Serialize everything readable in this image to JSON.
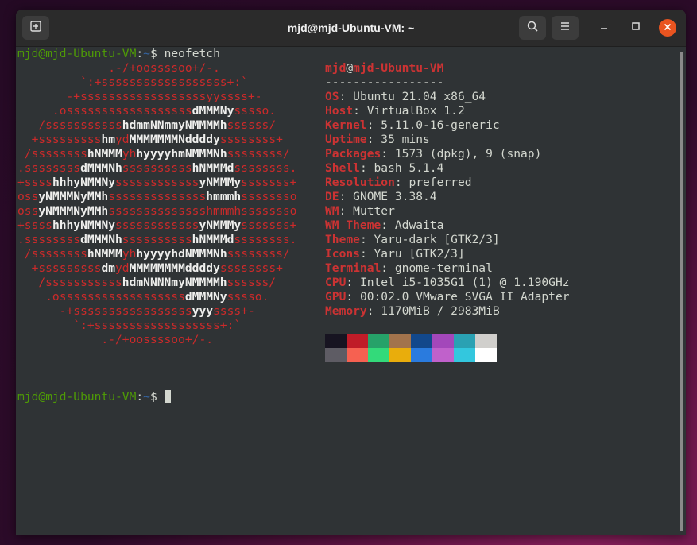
{
  "window": {
    "title": "mjd@mjd-Ubuntu-VM: ~",
    "icons": [
      "new-tab-icon",
      "search-icon",
      "hamburger-menu-icon",
      "minimize-icon",
      "maximize-icon",
      "close-icon"
    ]
  },
  "prompt": {
    "user_host": "mjd@mjd-Ubuntu-VM",
    "sep": ":",
    "dir": "~",
    "symbol": "$",
    "command": "neofetch"
  },
  "logo_lines": [
    [
      [
        "r",
        "             .-/+oossssoo+/-."
      ]
    ],
    [
      [
        "r",
        "         `:+ssssssssssssssssss+:`"
      ]
    ],
    [
      [
        "r",
        "       -+ssssssssssssssssssyyssss+-"
      ]
    ],
    [
      [
        "r",
        "     .ossssssssssssssssss"
      ],
      [
        "w",
        "dMMMNy"
      ],
      [
        "r",
        "sssso."
      ]
    ],
    [
      [
        "r",
        "   /sssssssssss"
      ],
      [
        "w",
        "hdmmNNmmyNMMMMh"
      ],
      [
        "r",
        "ssssss/"
      ]
    ],
    [
      [
        "r",
        "  +sssssssss"
      ],
      [
        "w",
        "hm"
      ],
      [
        "r",
        "yd"
      ],
      [
        "w",
        "MMMMMMMNddddy"
      ],
      [
        "r",
        "ssssssss+"
      ]
    ],
    [
      [
        "r",
        " /ssssssss"
      ],
      [
        "w",
        "hNMMM"
      ],
      [
        "r",
        "yh"
      ],
      [
        "w",
        "hyyyyhmNMMMNh"
      ],
      [
        "r",
        "ssssssss/"
      ]
    ],
    [
      [
        "r",
        ".ssssssss"
      ],
      [
        "w",
        "dMMMNh"
      ],
      [
        "r",
        "ssssssssss"
      ],
      [
        "w",
        "hNMMMd"
      ],
      [
        "r",
        "ssssssss."
      ]
    ],
    [
      [
        "r",
        "+ssss"
      ],
      [
        "w",
        "hhhyNMMNy"
      ],
      [
        "r",
        "ssssssssssss"
      ],
      [
        "w",
        "yNMMMy"
      ],
      [
        "r",
        "sssssss+"
      ]
    ],
    [
      [
        "r",
        "oss"
      ],
      [
        "w",
        "yNMMMNyMMh"
      ],
      [
        "r",
        "ssssssssssssss"
      ],
      [
        "w",
        "hmmmh"
      ],
      [
        "r",
        "ssssssso"
      ]
    ],
    [
      [
        "r",
        "oss"
      ],
      [
        "w",
        "yNMMMNyMMh"
      ],
      [
        "r",
        "sssssssssssssshmmmhssssssso"
      ]
    ],
    [
      [
        "r",
        "+ssss"
      ],
      [
        "w",
        "hhhyNMMNy"
      ],
      [
        "r",
        "ssssssssssss"
      ],
      [
        "w",
        "yNMMMy"
      ],
      [
        "r",
        "sssssss+"
      ]
    ],
    [
      [
        "r",
        ".ssssssss"
      ],
      [
        "w",
        "dMMMNh"
      ],
      [
        "r",
        "ssssssssss"
      ],
      [
        "w",
        "hNMMMd"
      ],
      [
        "r",
        "ssssssss."
      ]
    ],
    [
      [
        "r",
        " /ssssssss"
      ],
      [
        "w",
        "hNMMM"
      ],
      [
        "r",
        "yh"
      ],
      [
        "w",
        "hyyyyhdNMMMNh"
      ],
      [
        "r",
        "ssssssss/"
      ]
    ],
    [
      [
        "r",
        "  +sssssssss"
      ],
      [
        "w",
        "dm"
      ],
      [
        "r",
        "yd"
      ],
      [
        "w",
        "MMMMMMMMddddy"
      ],
      [
        "r",
        "ssssssss+"
      ]
    ],
    [
      [
        "r",
        "   /sssssssssss"
      ],
      [
        "w",
        "hdmNNNNmyNMMMMh"
      ],
      [
        "r",
        "ssssss/"
      ]
    ],
    [
      [
        "r",
        "    .ossssssssssssssssss"
      ],
      [
        "w",
        "dMMMNy"
      ],
      [
        "r",
        "sssso."
      ]
    ],
    [
      [
        "r",
        "      -+sssssssssssssssss"
      ],
      [
        "w",
        "yyy"
      ],
      [
        "r",
        "ssss+-"
      ]
    ],
    [
      [
        "r",
        "        `:+ssssssssssssssssss+:`"
      ]
    ],
    [
      [
        "r",
        "            .-/+oossssoo+/-."
      ]
    ]
  ],
  "info": {
    "user": "mjd",
    "at": "@",
    "host": "mjd-Ubuntu-VM",
    "divider": "-----------------",
    "rows": [
      {
        "key": "OS",
        "value": "Ubuntu 21.04 x86_64"
      },
      {
        "key": "Host",
        "value": "VirtualBox 1.2"
      },
      {
        "key": "Kernel",
        "value": "5.11.0-16-generic"
      },
      {
        "key": "Uptime",
        "value": "35 mins"
      },
      {
        "key": "Packages",
        "value": "1573 (dpkg), 9 (snap)"
      },
      {
        "key": "Shell",
        "value": "bash 5.1.4"
      },
      {
        "key": "Resolution",
        "value": "preferred"
      },
      {
        "key": "DE",
        "value": "GNOME 3.38.4"
      },
      {
        "key": "WM",
        "value": "Mutter"
      },
      {
        "key": "WM Theme",
        "value": "Adwaita"
      },
      {
        "key": "Theme",
        "value": "Yaru-dark [GTK2/3]"
      },
      {
        "key": "Icons",
        "value": "Yaru [GTK2/3]"
      },
      {
        "key": "Terminal",
        "value": "gnome-terminal"
      },
      {
        "key": "CPU",
        "value": "Intel i5-1035G1 (1) @ 1.190GHz"
      },
      {
        "key": "GPU",
        "value": "00:02.0 VMware SVGA II Adapter"
      },
      {
        "key": "Memory",
        "value": "1170MiB / 2983MiB"
      }
    ]
  },
  "palette": {
    "normal": [
      "#171421",
      "#c01c28",
      "#26a269",
      "#a2734c",
      "#12488b",
      "#a347ba",
      "#2aa1b3",
      "#d0cfcc"
    ],
    "bright": [
      "#5e5c64",
      "#f66151",
      "#33da7a",
      "#e9ad0c",
      "#2a7bde",
      "#c061cb",
      "#33c7de",
      "#ffffff"
    ]
  },
  "colors": {
    "prompt_user": "#4e9a06",
    "prompt_dir": "#3465a4",
    "accent_red": "#cc2a2a",
    "close_button": "#e95420"
  }
}
